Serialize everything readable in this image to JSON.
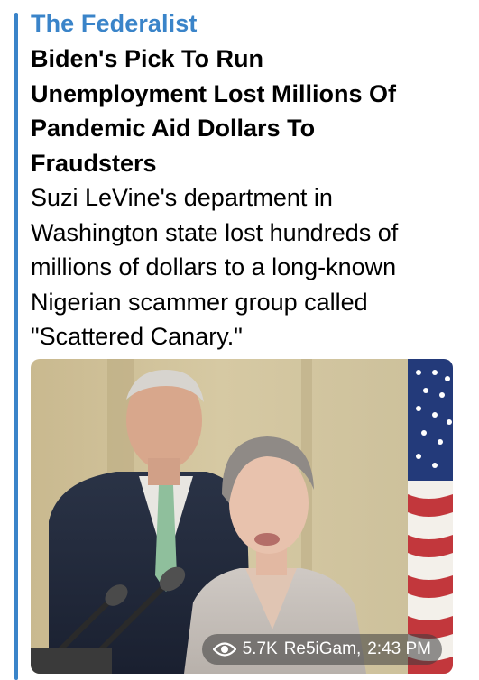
{
  "message": {
    "site_name": "The Federalist",
    "title": "Biden's Pick To Run Unemployment Lost Millions Of Pandemic Aid Dollars To Fraudsters",
    "description": "Suzi LeVine's department in Washington state lost hundreds of millions of dollars to a long-known Nigerian scammer group called \"Scattered Canary.\"",
    "views": "5.7K",
    "author": "Re5iGam",
    "time": "2:43 PM"
  },
  "colors": {
    "accent": "#3a84c9",
    "text": "#000000"
  },
  "icons": {
    "views": "eye-icon"
  }
}
